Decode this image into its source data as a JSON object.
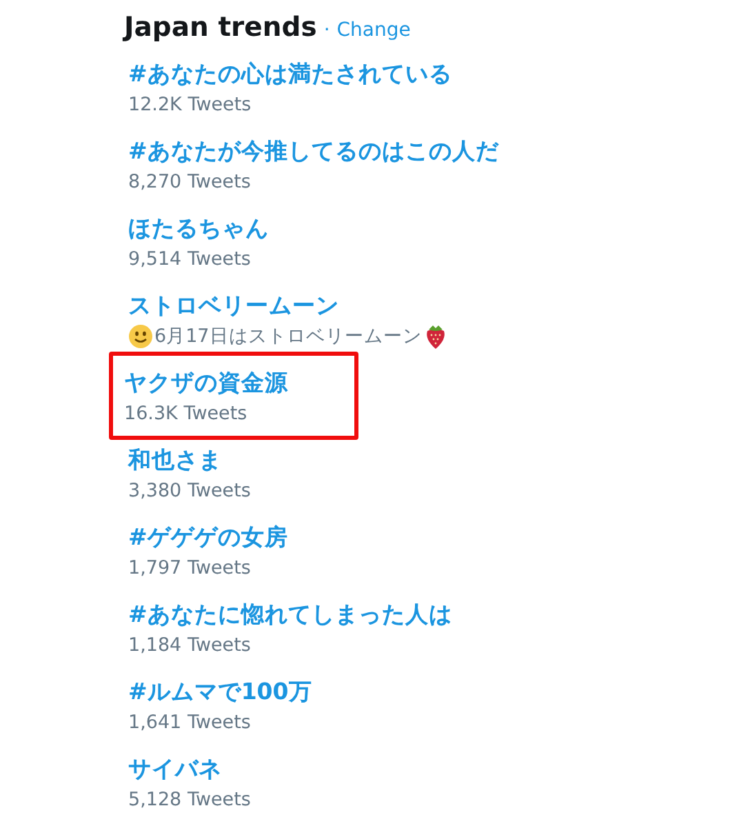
{
  "header": {
    "title": "Japan trends",
    "separator": "·",
    "link": "Change"
  },
  "trends": [
    {
      "name": "#あなたの心は満たされている",
      "kind": "count",
      "meta": "12.2K Tweets",
      "highlighted": false
    },
    {
      "name": "#あなたが今推してるのはこの人だ",
      "kind": "count",
      "meta": "8,270 Tweets",
      "highlighted": false
    },
    {
      "name": "ほたるちゃん",
      "kind": "count",
      "meta": "9,514 Tweets",
      "highlighted": false
    },
    {
      "name": "ストロベリームーン",
      "kind": "description",
      "meta": "6月17日はストロベリームーン",
      "highlighted": false
    },
    {
      "name": "ヤクザの資金源",
      "kind": "count",
      "meta": "16.3K Tweets",
      "highlighted": true
    },
    {
      "name": "和也さま",
      "kind": "count",
      "meta": "3,380 Tweets",
      "highlighted": false
    },
    {
      "name": "#ゲゲゲの女房",
      "kind": "count",
      "meta": "1,797 Tweets",
      "highlighted": false
    },
    {
      "name": "#あなたに惚れてしまった人は",
      "kind": "count",
      "meta": "1,184 Tweets",
      "highlighted": false
    },
    {
      "name": "#ルムマで100万",
      "kind": "count",
      "meta": "1,641 Tweets",
      "highlighted": false
    },
    {
      "name": "サイバネ",
      "kind": "count",
      "meta": "5,128 Tweets",
      "highlighted": false
    }
  ]
}
